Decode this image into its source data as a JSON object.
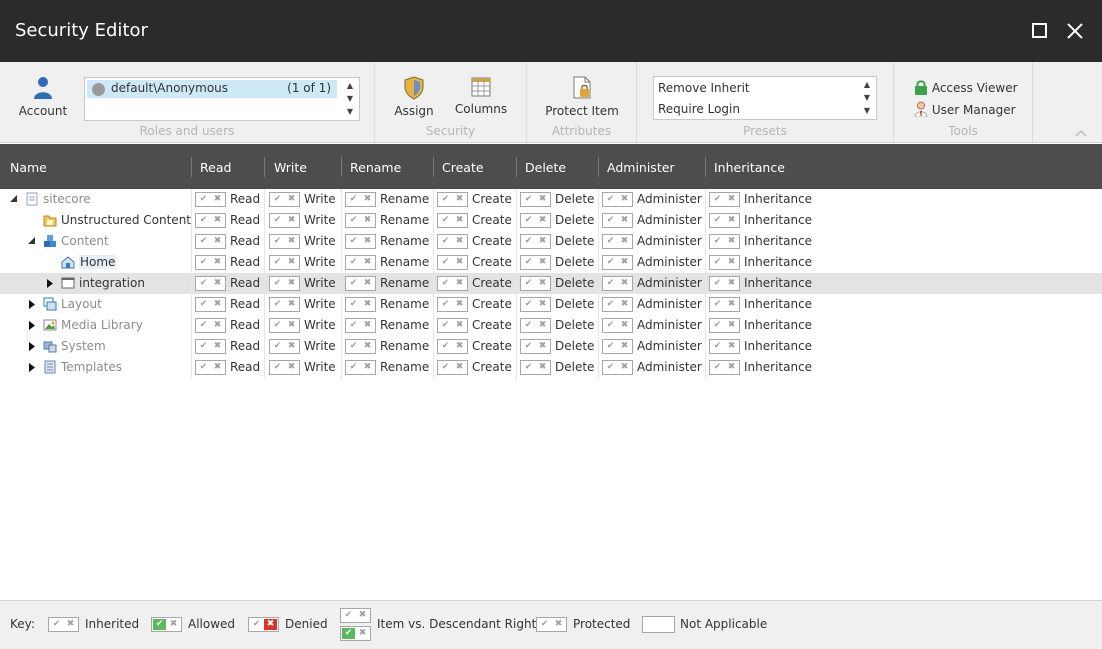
{
  "window": {
    "title": "Security Editor"
  },
  "ribbon": {
    "account_label": "Account",
    "roles": {
      "selected": "default\\Anonymous",
      "count": "(1 of 1)",
      "group_label": "Roles and users"
    },
    "security": {
      "assign_label": "Assign",
      "columns_label": "Columns",
      "group_label": "Security"
    },
    "attributes": {
      "protect_label": "Protect Item",
      "group_label": "Attributes"
    },
    "presets": {
      "options": [
        "Remove Inherit",
        "Require Login"
      ],
      "group_label": "Presets"
    },
    "tools": {
      "access_viewer": "Access Viewer",
      "user_manager": "User Manager",
      "group_label": "Tools"
    }
  },
  "grid": {
    "columns": [
      "Name",
      "Read",
      "Write",
      "Rename",
      "Create",
      "Delete",
      "Administer",
      "Inheritance"
    ],
    "rows": [
      {
        "name": "sitecore",
        "expanded": true,
        "dimmed": true,
        "icon": "page-icon"
      },
      {
        "name": "Unstructured Content",
        "expanded": null,
        "dimmed": false,
        "icon": "folder-icon"
      },
      {
        "name": "Content",
        "expanded": true,
        "dimmed": true,
        "icon": "content-cubes-icon"
      },
      {
        "name": "Home",
        "expanded": null,
        "dimmed": false,
        "icon": "home-icon"
      },
      {
        "name": "integration",
        "expanded": false,
        "dimmed": false,
        "icon": "window-icon",
        "selected": true
      },
      {
        "name": "Layout",
        "expanded": false,
        "dimmed": true,
        "icon": "layout-icon"
      },
      {
        "name": "Media Library",
        "expanded": false,
        "dimmed": true,
        "icon": "media-icon"
      },
      {
        "name": "System",
        "expanded": false,
        "dimmed": true,
        "icon": "system-icon"
      },
      {
        "name": "Templates",
        "expanded": false,
        "dimmed": true,
        "icon": "templates-icon"
      }
    ],
    "check_marks": {
      "allow": "✔",
      "deny": "✖"
    }
  },
  "key": {
    "label": "Key:",
    "inherited": "Inherited",
    "allowed": "Allowed",
    "denied": "Denied",
    "item_vs_descendant": "Item vs. Descendant Right",
    "protected": "Protected",
    "not_applicable": "Not Applicable"
  },
  "colors": {
    "titlebar": "#2b2b2b",
    "header": "#4d4d4d",
    "selection": "#cde8f7",
    "allowed": "#5cb85c",
    "denied": "#d9342b"
  }
}
